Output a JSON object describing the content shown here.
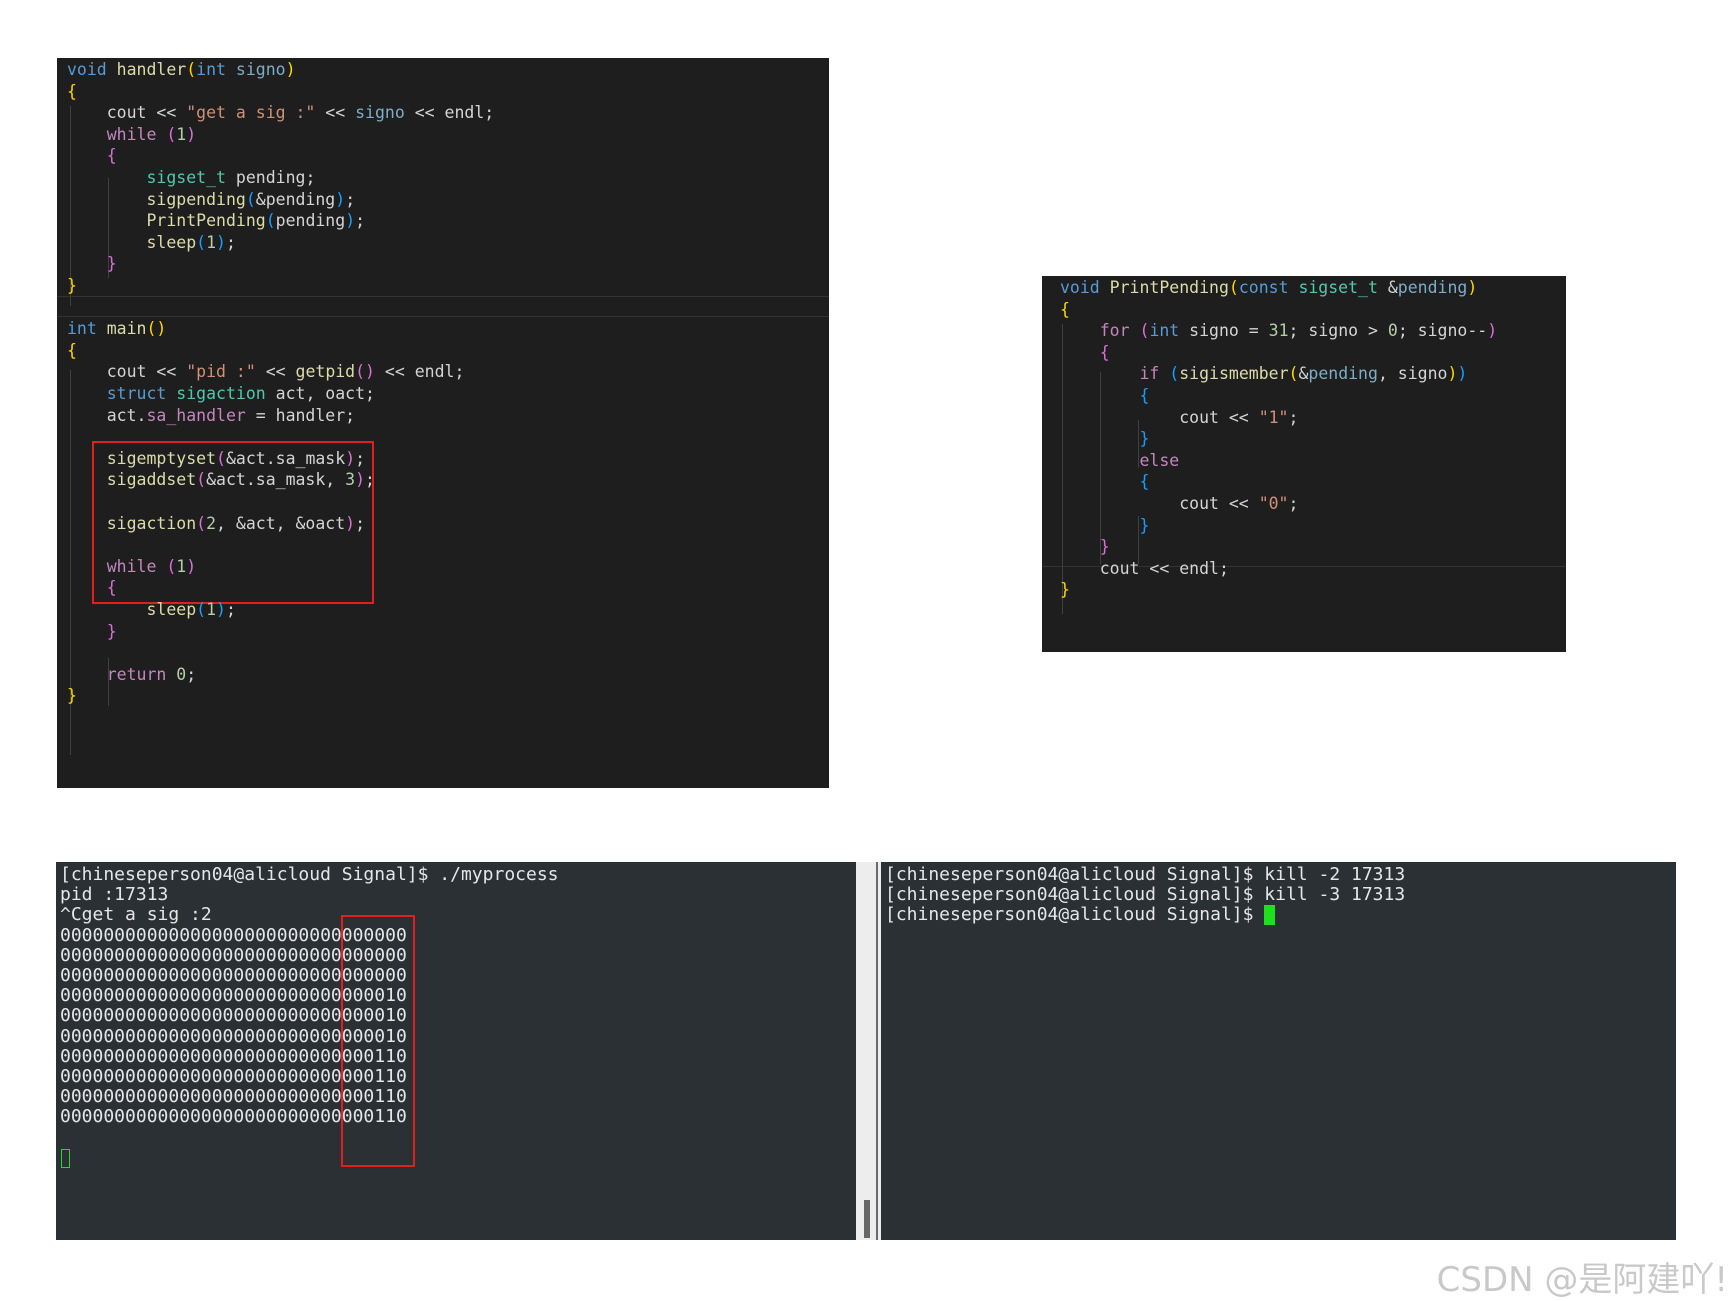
{
  "editor_main": {
    "lines": [
      {
        "name": "line-handler-signature",
        "parts": [
          {
            "t": "void",
            "c": "kw"
          },
          {
            "t": " handler",
            "c": "fn"
          },
          {
            "t": "(",
            "c": "br1"
          },
          {
            "t": "int",
            "c": "kw"
          },
          {
            "t": " signo",
            "c": "prm"
          },
          {
            "t": ")",
            "c": "br1"
          }
        ]
      },
      {
        "name": "line-handler-open",
        "parts": [
          {
            "t": "{",
            "c": "br1"
          }
        ]
      },
      {
        "name": "line-handler-cout",
        "parts": [
          {
            "t": "    cout << "
          },
          {
            "t": "\"get a sig :\"",
            "c": "str"
          },
          {
            "t": " << "
          },
          {
            "t": "signo",
            "c": "prm"
          },
          {
            "t": " << endl;"
          }
        ]
      },
      {
        "name": "line-handler-while",
        "parts": [
          {
            "t": "    "
          },
          {
            "t": "while",
            "c": "ctl"
          },
          {
            "t": " "
          },
          {
            "t": "(",
            "c": "br2"
          },
          {
            "t": "1",
            "c": "num"
          },
          {
            "t": ")",
            "c": "br2"
          }
        ]
      },
      {
        "name": "line-handler-while-open",
        "parts": [
          {
            "t": "    "
          },
          {
            "t": "{",
            "c": "br2"
          }
        ]
      },
      {
        "name": "line-sigset-decl",
        "parts": [
          {
            "t": "        "
          },
          {
            "t": "sigset_t",
            "c": "ty"
          },
          {
            "t": " pending;"
          }
        ]
      },
      {
        "name": "line-sigpending",
        "parts": [
          {
            "t": "        "
          },
          {
            "t": "sigpending",
            "c": "fn"
          },
          {
            "t": "(",
            "c": "br3"
          },
          {
            "t": "&pending"
          },
          {
            "t": ")",
            "c": "br3"
          },
          {
            "t": ";"
          }
        ]
      },
      {
        "name": "line-printpending-call",
        "parts": [
          {
            "t": "        "
          },
          {
            "t": "PrintPending",
            "c": "fn"
          },
          {
            "t": "(",
            "c": "br3"
          },
          {
            "t": "pending"
          },
          {
            "t": ")",
            "c": "br3"
          },
          {
            "t": ";"
          }
        ]
      },
      {
        "name": "line-handler-sleep",
        "parts": [
          {
            "t": "        "
          },
          {
            "t": "sleep",
            "c": "fn"
          },
          {
            "t": "(",
            "c": "br3"
          },
          {
            "t": "1",
            "c": "num"
          },
          {
            "t": ")",
            "c": "br3"
          },
          {
            "t": ";"
          }
        ]
      },
      {
        "name": "line-handler-while-close",
        "parts": [
          {
            "t": "    "
          },
          {
            "t": "}",
            "c": "br2"
          }
        ]
      },
      {
        "name": "line-handler-close",
        "parts": [
          {
            "t": "}",
            "c": "br1"
          }
        ]
      },
      {
        "name": "line-blank",
        "parts": []
      },
      {
        "name": "line-main-signature",
        "parts": [
          {
            "t": "int",
            "c": "kw"
          },
          {
            "t": " main",
            "c": "fn"
          },
          {
            "t": "()",
            "c": "br1"
          }
        ]
      },
      {
        "name": "line-main-open",
        "parts": [
          {
            "t": "{",
            "c": "br1"
          }
        ]
      },
      {
        "name": "line-main-cout",
        "parts": [
          {
            "t": "    cout << "
          },
          {
            "t": "\"pid :\"",
            "c": "str"
          },
          {
            "t": " << "
          },
          {
            "t": "getpid",
            "c": "fn"
          },
          {
            "t": "()",
            "c": "br2"
          },
          {
            "t": " << endl;"
          }
        ]
      },
      {
        "name": "line-struct-decl",
        "parts": [
          {
            "t": "    "
          },
          {
            "t": "struct",
            "c": "kw"
          },
          {
            "t": " "
          },
          {
            "t": "sigaction",
            "c": "ty"
          },
          {
            "t": " act, oact;"
          }
        ]
      },
      {
        "name": "line-sa-handler",
        "parts": [
          {
            "t": "    act."
          },
          {
            "t": "sa_handler",
            "c": "ctl"
          },
          {
            "t": " = handler;"
          }
        ]
      },
      {
        "name": "line-blank",
        "parts": []
      },
      {
        "name": "line-sigemptyset",
        "parts": [
          {
            "t": "    "
          },
          {
            "t": "sigemptyset",
            "c": "fn"
          },
          {
            "t": "(",
            "c": "br2"
          },
          {
            "t": "&act.sa_mask"
          },
          {
            "t": ")",
            "c": "br2"
          },
          {
            "t": ";"
          }
        ]
      },
      {
        "name": "line-sigaddset",
        "parts": [
          {
            "t": "    "
          },
          {
            "t": "sigaddset",
            "c": "fn"
          },
          {
            "t": "(",
            "c": "br2"
          },
          {
            "t": "&act.sa_mask, "
          },
          {
            "t": "3",
            "c": "num"
          },
          {
            "t": ")",
            "c": "br2"
          },
          {
            "t": ";"
          }
        ]
      },
      {
        "name": "line-blank",
        "parts": []
      },
      {
        "name": "line-sigaction",
        "parts": [
          {
            "t": "    "
          },
          {
            "t": "sigaction",
            "c": "fn"
          },
          {
            "t": "(",
            "c": "br2"
          },
          {
            "t": "2",
            "c": "num"
          },
          {
            "t": ", &act, &oact"
          },
          {
            "t": ")",
            "c": "br2"
          },
          {
            "t": ";"
          }
        ]
      },
      {
        "name": "line-blank",
        "parts": []
      },
      {
        "name": "line-main-while",
        "parts": [
          {
            "t": "    "
          },
          {
            "t": "while",
            "c": "ctl"
          },
          {
            "t": " "
          },
          {
            "t": "(",
            "c": "br2"
          },
          {
            "t": "1",
            "c": "num"
          },
          {
            "t": ")",
            "c": "br2"
          }
        ]
      },
      {
        "name": "line-main-while-open",
        "parts": [
          {
            "t": "    "
          },
          {
            "t": "{",
            "c": "br2"
          }
        ]
      },
      {
        "name": "line-main-sleep",
        "parts": [
          {
            "t": "        "
          },
          {
            "t": "sleep",
            "c": "fn"
          },
          {
            "t": "(",
            "c": "br3"
          },
          {
            "t": "1",
            "c": "num"
          },
          {
            "t": ")",
            "c": "br3"
          },
          {
            "t": ";"
          }
        ]
      },
      {
        "name": "line-main-while-close",
        "parts": [
          {
            "t": "    "
          },
          {
            "t": "}",
            "c": "br2"
          }
        ]
      },
      {
        "name": "line-blank",
        "parts": []
      },
      {
        "name": "line-return",
        "parts": [
          {
            "t": "    "
          },
          {
            "t": "return",
            "c": "ctl"
          },
          {
            "t": " "
          },
          {
            "t": "0",
            "c": "num"
          },
          {
            "t": ";"
          }
        ]
      },
      {
        "name": "line-main-close",
        "parts": [
          {
            "t": "}",
            "c": "br1"
          }
        ]
      }
    ]
  },
  "editor_print": {
    "lines": [
      {
        "name": "line-printpending-signature",
        "parts": [
          {
            "t": "void",
            "c": "kw"
          },
          {
            "t": " PrintPending",
            "c": "fn"
          },
          {
            "t": "(",
            "c": "br1"
          },
          {
            "t": "const",
            "c": "kw"
          },
          {
            "t": " "
          },
          {
            "t": "sigset_t",
            "c": "ty"
          },
          {
            "t": " &"
          },
          {
            "t": "pending",
            "c": "prm"
          },
          {
            "t": ")",
            "c": "br1"
          }
        ]
      },
      {
        "name": "line-printpending-open",
        "parts": [
          {
            "t": "{",
            "c": "br1"
          }
        ]
      },
      {
        "name": "line-for",
        "parts": [
          {
            "t": "    "
          },
          {
            "t": "for",
            "c": "ctl"
          },
          {
            "t": " "
          },
          {
            "t": "(",
            "c": "br2"
          },
          {
            "t": "int",
            "c": "kw"
          },
          {
            "t": " signo = "
          },
          {
            "t": "31",
            "c": "num"
          },
          {
            "t": "; signo > "
          },
          {
            "t": "0",
            "c": "num"
          },
          {
            "t": "; signo--"
          },
          {
            "t": ")",
            "c": "br2"
          }
        ]
      },
      {
        "name": "line-for-open",
        "parts": [
          {
            "t": "    "
          },
          {
            "t": "{",
            "c": "br2"
          }
        ]
      },
      {
        "name": "line-if",
        "parts": [
          {
            "t": "        "
          },
          {
            "t": "if",
            "c": "ctl"
          },
          {
            "t": " "
          },
          {
            "t": "(",
            "c": "br3"
          },
          {
            "t": "sigismember",
            "c": "fn"
          },
          {
            "t": "(",
            "c": "br1"
          },
          {
            "t": "&"
          },
          {
            "t": "pending",
            "c": "prm"
          },
          {
            "t": ", signo"
          },
          {
            "t": ")",
            "c": "br1"
          },
          {
            "t": ")",
            "c": "br3"
          }
        ]
      },
      {
        "name": "line-if-open",
        "parts": [
          {
            "t": "        "
          },
          {
            "t": "{",
            "c": "br3"
          }
        ]
      },
      {
        "name": "line-cout-1",
        "parts": [
          {
            "t": "            cout << "
          },
          {
            "t": "\"1\"",
            "c": "str"
          },
          {
            "t": ";"
          }
        ]
      },
      {
        "name": "line-if-close",
        "parts": [
          {
            "t": "        "
          },
          {
            "t": "}",
            "c": "br3"
          }
        ]
      },
      {
        "name": "line-else",
        "parts": [
          {
            "t": "        "
          },
          {
            "t": "else",
            "c": "ctl"
          }
        ]
      },
      {
        "name": "line-else-open",
        "parts": [
          {
            "t": "        "
          },
          {
            "t": "{",
            "c": "br3"
          }
        ]
      },
      {
        "name": "line-cout-0",
        "parts": [
          {
            "t": "            cout << "
          },
          {
            "t": "\"0\"",
            "c": "str"
          },
          {
            "t": ";"
          }
        ]
      },
      {
        "name": "line-else-close",
        "parts": [
          {
            "t": "        "
          },
          {
            "t": "}",
            "c": "br3"
          }
        ]
      },
      {
        "name": "line-for-close",
        "parts": [
          {
            "t": "    "
          },
          {
            "t": "}",
            "c": "br2"
          }
        ]
      },
      {
        "name": "line-cout-endl",
        "parts": [
          {
            "t": "    cout << endl;"
          }
        ]
      },
      {
        "name": "line-printpending-close",
        "parts": [
          {
            "t": "}",
            "c": "br1"
          }
        ]
      }
    ]
  },
  "terminal_left": {
    "lines": [
      "[chineseperson04@alicloud Signal]$ ./myprocess",
      "pid :17313",
      "^Cget a sig :2",
      "00000000000000000000000000000000",
      "00000000000000000000000000000000",
      "00000000000000000000000000000000",
      "00000000000000000000000000000010",
      "00000000000000000000000000000010",
      "00000000000000000000000000000010",
      "00000000000000000000000000000110",
      "00000000000000000000000000000110",
      "00000000000000000000000000000110",
      "00000000000000000000000000000110"
    ]
  },
  "terminal_right": {
    "lines": [
      "[chineseperson04@alicloud Signal]$ kill -2 17313",
      "[chineseperson04@alicloud Signal]$ kill -3 17313",
      "[chineseperson04@alicloud Signal]$ "
    ]
  },
  "watermark": "CSDN @是阿建吖!",
  "colors": {
    "editor_bg": "#1e1e1e",
    "terminal_bg": "#2b3035",
    "highlight_box": "#e0201f",
    "cursor": "#1fe01f"
  }
}
